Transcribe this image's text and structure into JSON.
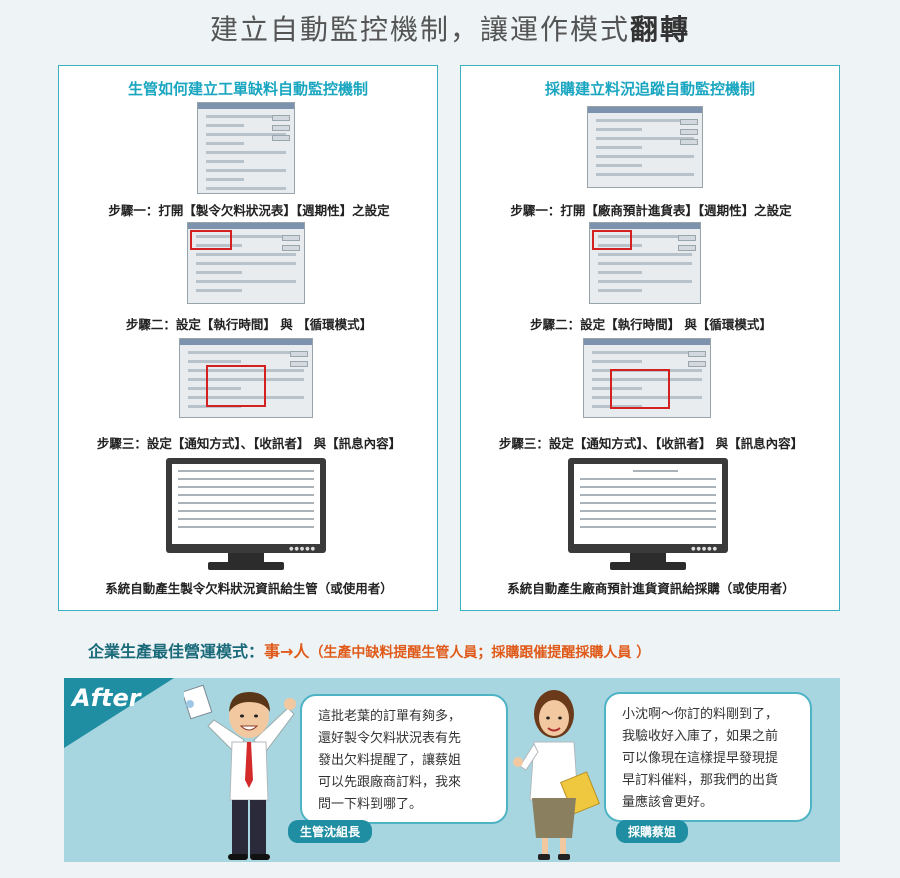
{
  "title_plain": "建立自動監控機制，讓運作模式",
  "title_bold": "翻轉",
  "left_panel": {
    "title": "生管如何建立工單缺料自動監控機制",
    "step1": "步驟一：打開【製令欠料狀況表】【週期性】之設定",
    "step2": "步驟二：設定【執行時間】 與 【循環模式】",
    "step3": "步驟三：設定【通知方式】、【收訊者】 與【訊息內容】",
    "summary": "系統自動產生製令欠料狀況資訊給生管（或使用者）"
  },
  "right_panel": {
    "title": "採購建立料況追蹤自動監控機制",
    "step1": "步驟一：打開【廠商預計進貨表】【週期性】之設定",
    "step2": "步驟二：設定【執行時間】 與【循環模式】",
    "step3": "步驟三：設定【通知方式】、【收訊者】 與【訊息內容】",
    "summary": "系統自動產生廠商預計進貨資訊給採購（或使用者）"
  },
  "mode": {
    "label": "企業生產最佳營運模式：",
    "people": "事→人",
    "desc": "（生產中缺料提醒生管人員；採購跟催提醒採購人員 ）"
  },
  "after": {
    "label": "After",
    "bubble_left": [
      "這批老葉的訂單有夠多，",
      "還好製令欠料狀況表有先",
      "發出欠料提醒了，讓蔡姐",
      "可以先跟廠商訂料，我來",
      "問一下料到哪了。"
    ],
    "tag_left": "生管沈組長",
    "bubble_right": [
      "小沈啊～你訂的料剛到了，",
      "我驗收好入庫了，如果之前",
      "可以像現在這樣提早發現提",
      "早訂料催料，那我們的出貨",
      "量應該會更好。"
    ],
    "tag_right": "採購蔡姐"
  },
  "colors": {
    "accent": "#1aa6c0",
    "highlight": "#e05a1a",
    "banner": "#1f8ea2",
    "after_bg": "#a8d6e0"
  }
}
